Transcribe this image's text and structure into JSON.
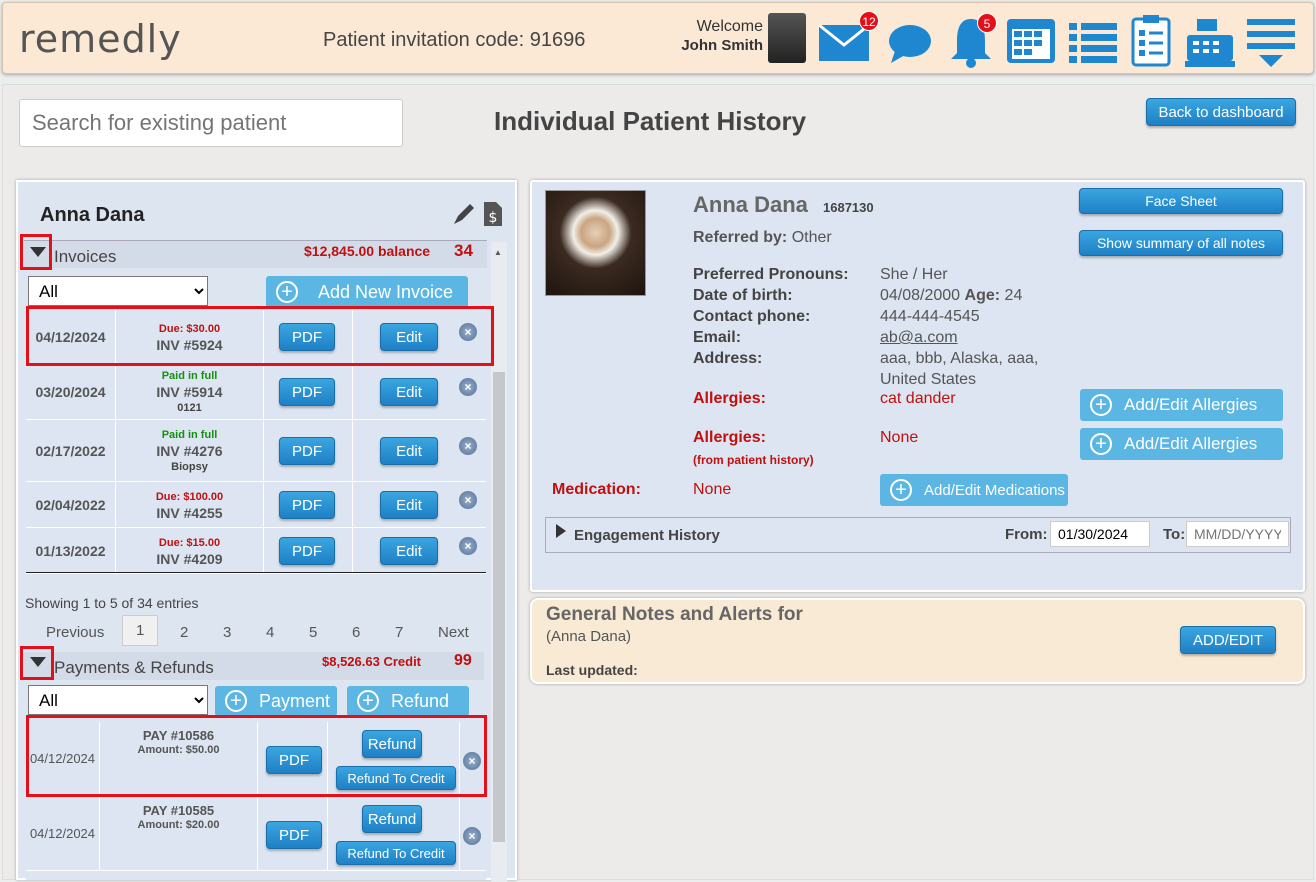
{
  "header": {
    "logo": "remedly",
    "invitation": "Patient invitation code: 91696",
    "welcome": "Welcome",
    "user": "John Smith",
    "mail_count": "12",
    "bell_count": "5"
  },
  "search": {
    "placeholder": "Search for existing patient"
  },
  "page_title": "Individual Patient History",
  "back_button": "Back to dashboard",
  "left": {
    "patient_name": "Anna Dana",
    "invoices": {
      "label": "Invoices",
      "balance": "$12,845.00 balance",
      "count": "34",
      "filter": "All",
      "add_button": "Add New Invoice",
      "rows": [
        {
          "date": "04/12/2024",
          "status": "Due: $30.00",
          "status_type": "due",
          "inv": "INV #5924",
          "note": "",
          "pdf": "PDF",
          "edit": "Edit"
        },
        {
          "date": "03/20/2024",
          "status": "Paid in full",
          "status_type": "paid",
          "inv": "INV #5914",
          "note": "0121",
          "pdf": "PDF",
          "edit": "Edit"
        },
        {
          "date": "02/17/2022",
          "status": "Paid in full",
          "status_type": "paid",
          "inv": "INV #4276",
          "note": "Biopsy",
          "pdf": "PDF",
          "edit": "Edit"
        },
        {
          "date": "02/04/2022",
          "status": "Due: $100.00",
          "status_type": "due",
          "inv": "INV #4255",
          "note": "",
          "pdf": "PDF",
          "edit": "Edit"
        },
        {
          "date": "01/13/2022",
          "status": "Due: $15.00",
          "status_type": "due",
          "inv": "INV #4209",
          "note": "",
          "pdf": "PDF",
          "edit": "Edit"
        }
      ],
      "showing": "Showing 1 to 5 of 34 entries",
      "pagination": [
        "Previous",
        "1",
        "2",
        "3",
        "4",
        "5",
        "6",
        "7",
        "Next"
      ]
    },
    "payments": {
      "label": "Payments & Refunds",
      "credit": "$8,526.63 Credit",
      "count": "99",
      "filter": "All",
      "payment_button": "Payment",
      "refund_button": "Refund",
      "rows": [
        {
          "date": "04/12/2024",
          "pay": "PAY #10586",
          "amount": "Amount: $50.00",
          "pdf": "PDF",
          "refund": "Refund",
          "refund_credit": "Refund To Credit"
        },
        {
          "date": "04/12/2024",
          "pay": "PAY #10585",
          "amount": "Amount: $20.00",
          "pdf": "PDF",
          "refund": "Refund",
          "refund_credit": "Refund To Credit"
        }
      ]
    }
  },
  "profile": {
    "name": "Anna Dana",
    "id": "1687130",
    "referred_label": "Referred by:",
    "referred": "Other",
    "pronouns_label": "Preferred Pronouns:",
    "pronouns": "She / Her",
    "dob_label": "Date of birth:",
    "dob": "04/08/2000",
    "age_label": "Age:",
    "age": "24",
    "phone_label": "Contact phone:",
    "phone": "444-444-4545",
    "email_label": "Email:",
    "email": "ab@a.com",
    "address_label": "Address:",
    "address1": "aaa, bbb, Alaska, aaa,",
    "address2": "United States",
    "allergies_label": "Allergies:",
    "allergies": "cat dander",
    "allergies2_label": "Allergies:",
    "allergies2_sub": "(from patient history)",
    "allergies2": "None",
    "medication_label": "Medication:",
    "medication": "None",
    "face_sheet": "Face Sheet",
    "summary": "Show summary of all notes",
    "add_allergies": "Add/Edit Allergies",
    "add_medications": "Add/Edit Medications",
    "engagement": "Engagement History",
    "from_label": "From:",
    "from": "01/30/2024",
    "to_label": "To:",
    "to_placeholder": "MM/DD/YYYY"
  },
  "notes": {
    "title": "General Notes and Alerts for",
    "subtitle": "(Anna Dana)",
    "last_updated": "Last updated:",
    "button": "ADD/EDIT"
  }
}
